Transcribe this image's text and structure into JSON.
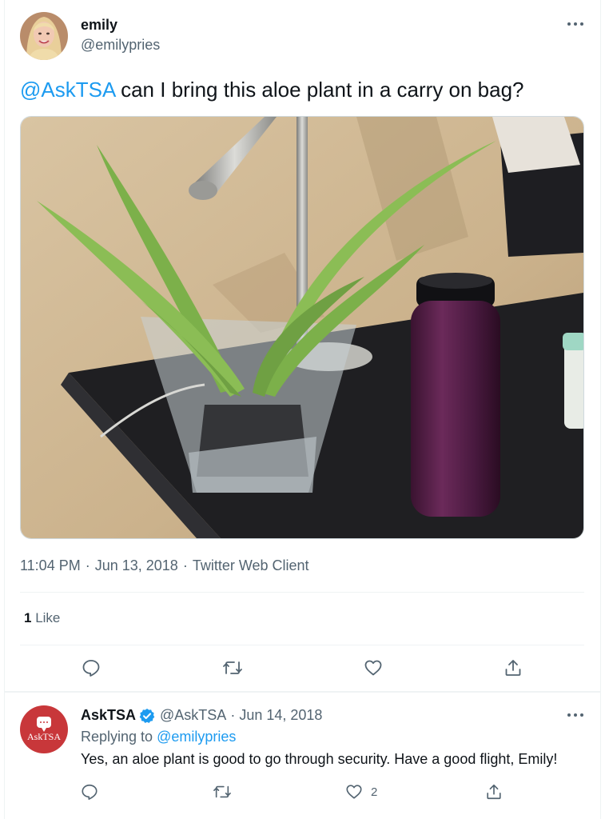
{
  "tweet": {
    "author": {
      "name": "emily",
      "handle": "@emilypries"
    },
    "text": {
      "mention": "@AskTSA",
      "body": " can I bring this aloe plant in a carry on bag?"
    },
    "meta": {
      "time": "11:04 PM",
      "date": "Jun 13, 2018",
      "client": "Twitter Web Client",
      "separator": "·"
    },
    "likes": {
      "count": "1",
      "label": " Like"
    },
    "actions": [
      {
        "name": "reply",
        "icon": "reply-icon"
      },
      {
        "name": "retweet",
        "icon": "retweet-icon"
      },
      {
        "name": "like",
        "icon": "heart-icon"
      },
      {
        "name": "share",
        "icon": "share-icon"
      }
    ]
  },
  "reply": {
    "author": {
      "name": "AskTSA",
      "handle": "@AskTSA",
      "verified": true,
      "avatar_text": "AskTSA"
    },
    "date": "Jun 14, 2018",
    "separator": "·",
    "replying_to_label": "Replying to ",
    "replying_to_handle": "@emilypries",
    "text": "Yes, an aloe plant is good to go through security. Have a good flight, Emily!",
    "actions": [
      {
        "name": "reply",
        "icon": "reply-icon"
      },
      {
        "name": "retweet",
        "icon": "retweet-icon"
      },
      {
        "name": "like",
        "icon": "heart-icon",
        "count": "2"
      },
      {
        "name": "share",
        "icon": "share-icon"
      }
    ]
  },
  "colors": {
    "link": "#1d9bf0",
    "secondary_text": "#536471",
    "primary_text": "#0f1419",
    "verified": "#1d9bf0",
    "asktsa_avatar": "#c8373a"
  }
}
